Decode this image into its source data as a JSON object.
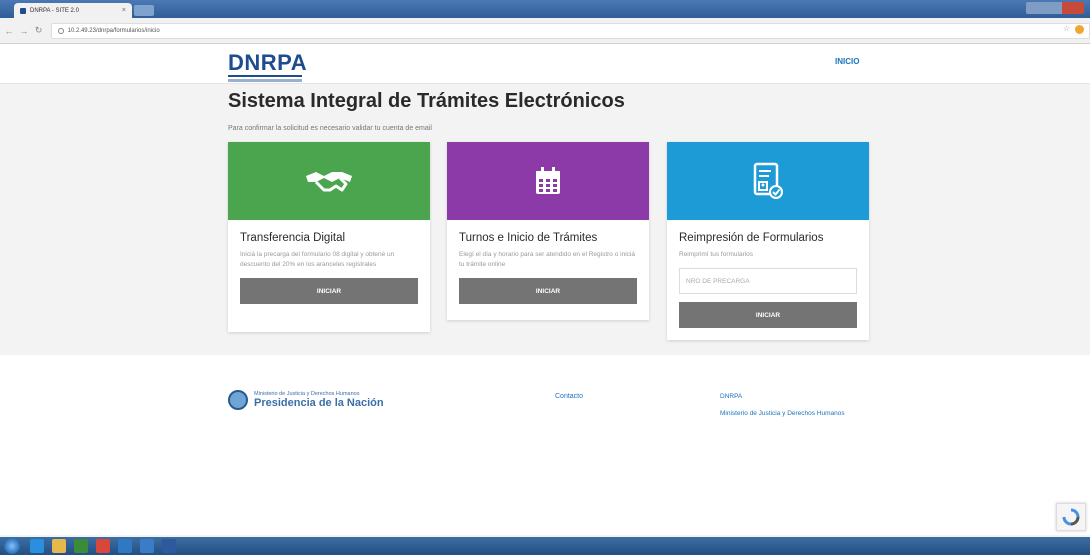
{
  "browser": {
    "tab_title": "DNRPA - SITE 2.0",
    "url": "10.2.49.23/dnrpa/formularios/inicio",
    "tab_close": "×"
  },
  "header": {
    "logo": "DNRPA",
    "nav_inicio": "INICIO"
  },
  "hero": {
    "title": "Sistema Integral de Trámites Electrónicos",
    "subtitle": "Para confirmar la solicitud es necesario validar tu cuenta de email"
  },
  "cards": [
    {
      "icon": "handshake-icon",
      "color": "#4aa54e",
      "title": "Transferencia Digital",
      "description": "Iniciá la precarga del formulario 08 digital y obtené un descuento del 20% en los aranceles registrales",
      "button": "INICIAR"
    },
    {
      "icon": "calendar-icon",
      "color": "#8c3aa8",
      "title": "Turnos e Inicio de Trámites",
      "description": "Elegí el día y horario para ser atendido en el Registro o iniciá tu trámite online",
      "button": "INICIAR"
    },
    {
      "icon": "form-document-icon",
      "color": "#1d9bd7",
      "title": "Reimpresión de Formularios",
      "description": "Reimprimí tus formularios",
      "input_placeholder": "NRO DE PRECARGA",
      "button": "INICIAR"
    }
  ],
  "footer": {
    "ministry_small": "Ministerio de Justicia y Derechos Humanos",
    "ministry_big": "Presidencia de la Nación",
    "contacto": "Contacto",
    "link_dnrpa": "DNRPA",
    "link_ministerio": "Ministerio de Justicia y Derechos Humanos"
  }
}
